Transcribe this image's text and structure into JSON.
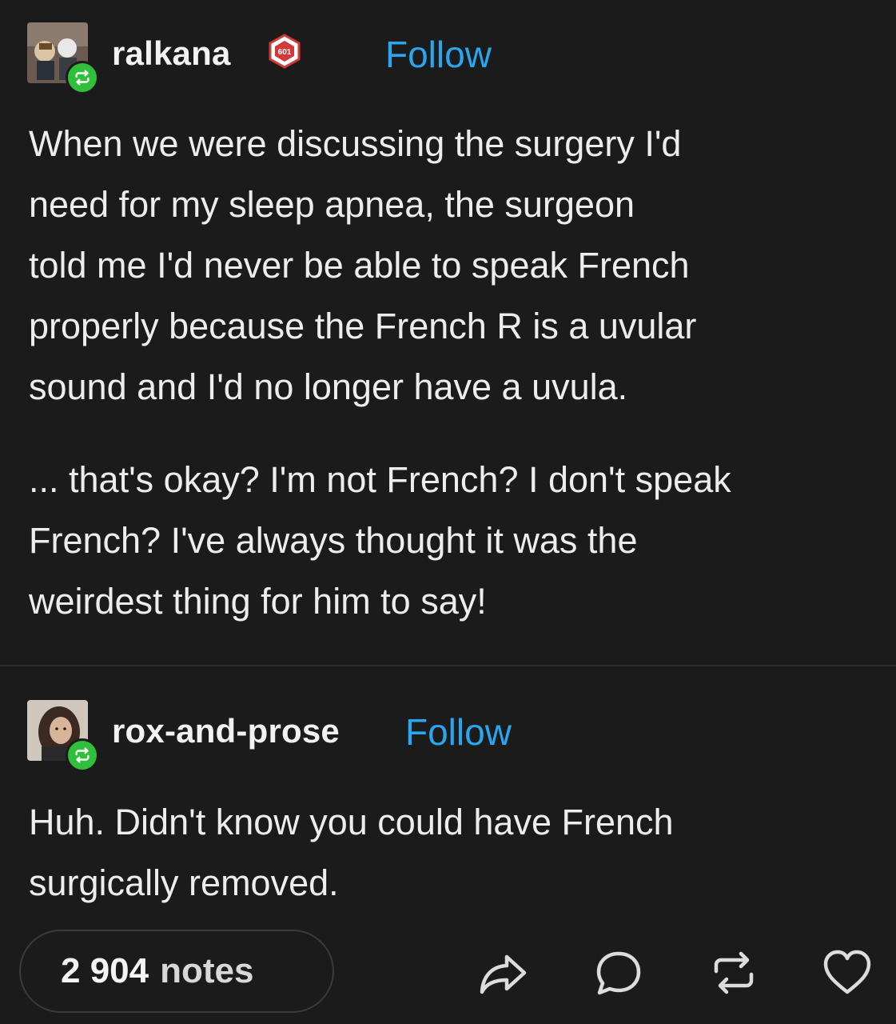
{
  "post1": {
    "username": "ralkana",
    "badge_text": "601",
    "follow_label": "Follow",
    "paragraph1": [
      "When we were discussing the surgery I'd",
      "need for my sleep apnea, the surgeon",
      "told me I'd never be able to speak French",
      "properly because the French R is a uvular",
      "sound and I'd no longer have a uvula."
    ],
    "paragraph2": [
      "... that's okay? I'm not French? I don't speak",
      "French? I've always thought it was the",
      "weirdest thing for him to say!"
    ]
  },
  "post2": {
    "username": "rox-and-prose",
    "follow_label": "Follow",
    "paragraph1": [
      "Huh. Didn't know you could have French",
      "surgically removed."
    ]
  },
  "footer": {
    "notes_count": "2 904",
    "notes_label": "notes",
    "icons": [
      "share-icon",
      "comment-icon",
      "reblog-icon",
      "heart-icon"
    ]
  },
  "colors": {
    "background": "#1b1b1b",
    "follow": "#2aa6ee",
    "reblog_badge": "#2fbf3a"
  }
}
